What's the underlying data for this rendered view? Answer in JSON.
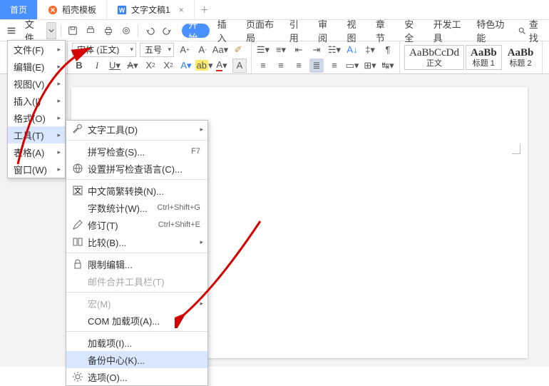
{
  "tabs": {
    "home": "首页",
    "templates": "稻壳模板",
    "doc1": "文字文稿1"
  },
  "menubar": {
    "file": "文件",
    "menus": [
      "开始",
      "插入",
      "页面布局",
      "引用",
      "审阅",
      "视图",
      "章节",
      "安全",
      "开发工具",
      "特色功能"
    ],
    "search": "查找"
  },
  "ribbon": {
    "format_painter": "格式刷",
    "font_name": "宋体 (正文)",
    "font_size": "五号",
    "styles": [
      {
        "sample": "AaBbCcDd",
        "label": "正文"
      },
      {
        "sample": "AaBb",
        "label": "标题 1"
      },
      {
        "sample": "AaBb",
        "label": "标题 2"
      }
    ]
  },
  "filemenu": [
    {
      "label": "文件(F)",
      "sub": true
    },
    {
      "label": "编辑(E)",
      "sub": true
    },
    {
      "label": "视图(V)",
      "sub": true
    },
    {
      "label": "插入(I)",
      "sub": true
    },
    {
      "label": "格式(O)",
      "sub": true
    },
    {
      "label": "工具(T)",
      "sub": true,
      "sel": true
    },
    {
      "label": "表格(A)",
      "sub": true
    },
    {
      "label": "窗口(W)",
      "sub": true
    }
  ],
  "toolmenu": [
    {
      "icon": "wrench",
      "label": "文字工具(D)",
      "sub": true
    },
    {
      "icon": "",
      "label": "拼写检查(S)...",
      "shortcut": "F7"
    },
    {
      "icon": "globe",
      "label": "设置拼写检查语言(C)..."
    },
    {
      "icon": "zhongwen",
      "label": "中文简繁转换(N)..."
    },
    {
      "icon": "",
      "label": "字数统计(W)...",
      "shortcut": "Ctrl+Shift+G"
    },
    {
      "icon": "pencil",
      "label": "修订(T)",
      "shortcut": "Ctrl+Shift+E"
    },
    {
      "icon": "compare",
      "label": "比较(B)...",
      "sub": true
    },
    {
      "icon": "lock",
      "label": "限制编辑..."
    },
    {
      "icon": "",
      "label": "邮件合并工具栏(T)",
      "disabled": true
    },
    {
      "icon": "",
      "label": "宏(M)",
      "disabled": true,
      "sub": true
    },
    {
      "icon": "",
      "label": "COM 加载项(A)..."
    },
    {
      "icon": "",
      "label": "加载项(I)..."
    },
    {
      "icon": "",
      "label": "备份中心(K)...",
      "sel": true
    },
    {
      "icon": "gear",
      "label": "选项(O)..."
    }
  ]
}
